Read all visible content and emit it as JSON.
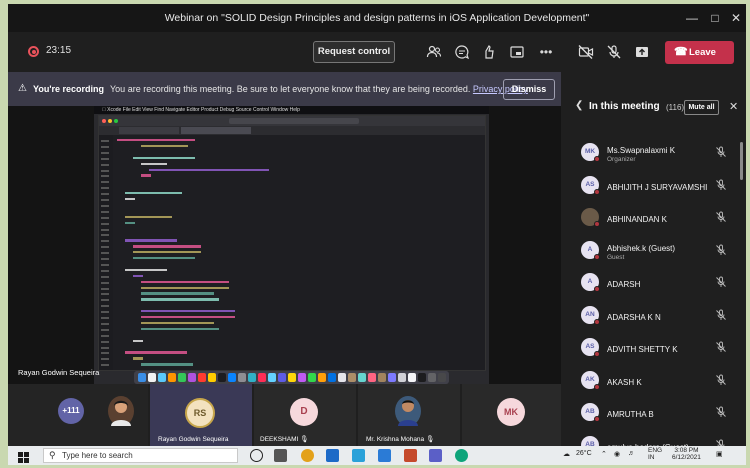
{
  "window": {
    "title": "Webinar on \"SOLID Design Principles and design patterns in iOS Application Development\"",
    "controls": [
      "minimize-icon",
      "maximize-icon",
      "close-icon"
    ]
  },
  "toolbar": {
    "timer": "23:15",
    "request_control_label": "Request control",
    "leave_label": "Leave",
    "icons": [
      "people-icon",
      "chat-icon",
      "reactions-icon",
      "share-screen-icon",
      "more-icon",
      "camera-off-icon",
      "mic-off-icon",
      "share-tray-icon"
    ],
    "leave_color": "#c4314b"
  },
  "banner": {
    "title": "You're recording",
    "text": "You are recording this meeting. Be sure to let everyone know that they are being recorded.",
    "link": "Privacy policy",
    "dismiss_label": "Dismiss"
  },
  "shared_screen": {
    "presenter": "Rayan Godwin Sequeira"
  },
  "gallery": {
    "overflow_count": "+111",
    "tiles": [
      {
        "name": "Rayan Godwin Sequeira",
        "initials": "RS"
      },
      {
        "name": "DEEKSHAMI",
        "initials": "D"
      },
      {
        "name": "Mr. Krishna Mohana",
        "initials": ""
      },
      {
        "name": "",
        "initials": "MK"
      }
    ]
  },
  "panel": {
    "title": "In this meeting",
    "count": "(116)",
    "mute_all_label": "Mute all",
    "participants": [
      {
        "initials": "MK",
        "name": "Ms.Swapnalaxmi K",
        "sub": "Organizer"
      },
      {
        "initials": "AS",
        "name": "ABHIJITH J SURYAVAMSHI",
        "sub": ""
      },
      {
        "initials": "",
        "name": "ABHINANDAN K",
        "sub": ""
      },
      {
        "initials": "A",
        "name": "Abhishek.k (Guest)",
        "sub": "Guest"
      },
      {
        "initials": "A",
        "name": "ADARSH",
        "sub": ""
      },
      {
        "initials": "AN",
        "name": "ADARSHA K N",
        "sub": ""
      },
      {
        "initials": "AS",
        "name": "ADVITH SHETTY K",
        "sub": ""
      },
      {
        "initials": "AK",
        "name": "AKASH K",
        "sub": ""
      },
      {
        "initials": "AB",
        "name": "AMRUTHA B",
        "sub": ""
      },
      {
        "initials": "AB",
        "name": "amulya bedare (Guest)",
        "sub": ""
      }
    ]
  },
  "taskbar": {
    "search_placeholder": "Type here to search",
    "weather": "26°C",
    "lang": "ENG",
    "region": "IN",
    "time": "3:08 PM",
    "date": "6/12/2021"
  }
}
